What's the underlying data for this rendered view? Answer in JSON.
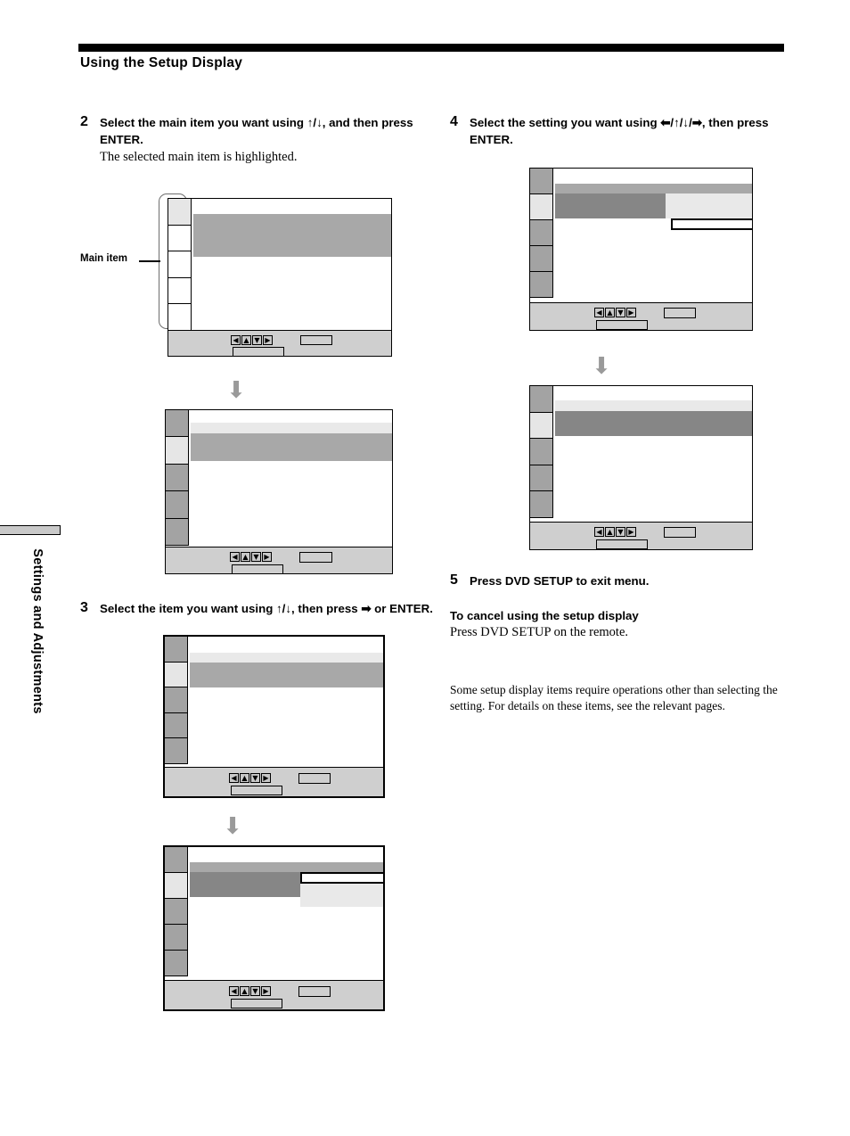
{
  "page": {
    "heading": "Using the Setup Display",
    "side_tab_label": "Settings and Adjustments"
  },
  "steps": {
    "step2": {
      "number": "2",
      "title": "Select the main item you want using ↑/↓, and then press ENTER.",
      "sub": "The selected main item is highlighted."
    },
    "step3": {
      "number": "3",
      "title": "Select the item you want using ↑/↓, then press ➡ or ENTER."
    },
    "step4": {
      "number": "4",
      "title": "Select the setting you want using ⬅/↑/↓/➡, then press ENTER."
    },
    "step5": {
      "number": "5",
      "title": "Press DVD SETUP to exit menu."
    }
  },
  "cancel_section": {
    "heading": "To cancel using the setup display",
    "body": "Press DVD SETUP on the remote."
  },
  "note": "Some setup display items require operations other than selecting the setting.  For details on these items, see the relevant pages.",
  "callout": {
    "label": "Main item"
  },
  "figure_flow_arrow": "⬇",
  "keypad": {
    "left_icon": "◀",
    "up_icon": "▲",
    "down_icon": "▼",
    "right_icon": "▶"
  },
  "colors": {
    "selected_row": "#a8a8a8",
    "focused_row": "#868686",
    "inactive_row": "#e9e9e9",
    "sidebar_cell": "#a3a3a3",
    "sidebar_cell_active": "#e6e6e6",
    "footer_bar": "#cfcfcf",
    "rule": "#000000"
  },
  "figures": {
    "fig1_caption_id": "setup-display-main-items",
    "fig2_caption_id": "setup-display-main-item-selected",
    "fig3_caption_id": "setup-display-sub-items",
    "fig4_caption_id": "setup-display-sub-item-selected",
    "fig5_caption_id": "setup-display-setting-list",
    "fig6_caption_id": "setup-display-setting-chosen"
  }
}
